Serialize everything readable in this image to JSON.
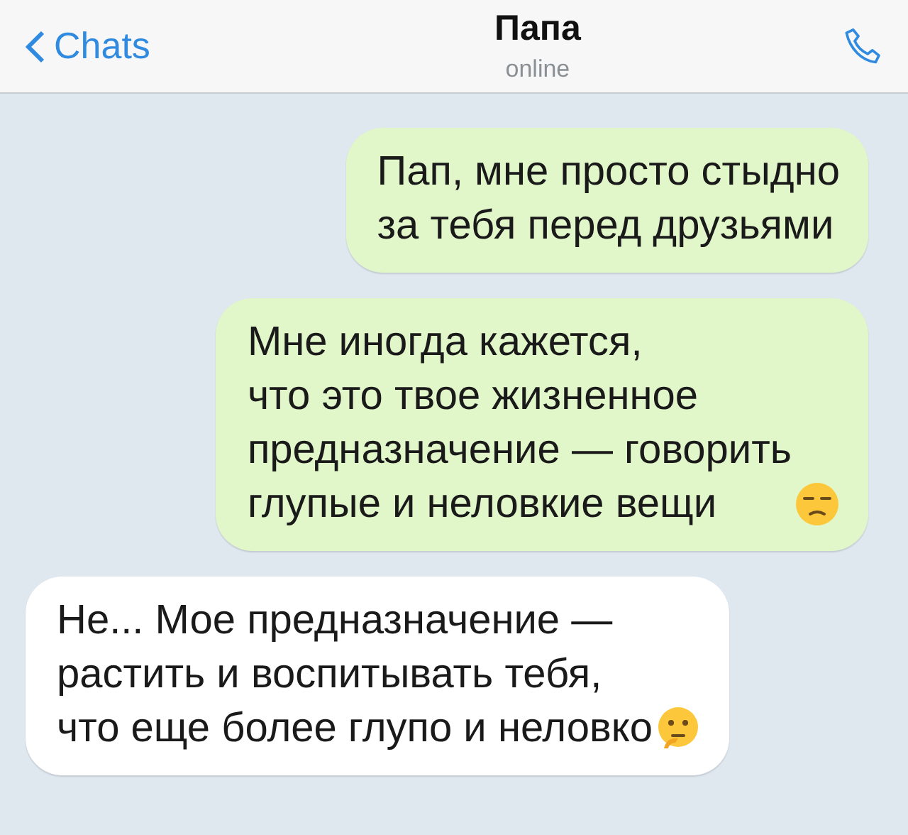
{
  "header": {
    "back": "Chats",
    "title": "Папа",
    "status": "online"
  },
  "messages": [
    {
      "kind": "outgoing",
      "text": "Пап, мне просто стыдно\nза тебя перед друзьями"
    },
    {
      "kind": "outgoing",
      "text": "Мне иногда кажется,\nчто это твое жизненное\nпредназначение — говорить\nглупые и неловкие вещи",
      "emoji": {
        "kind": "unamused"
      }
    },
    {
      "kind": "incoming",
      "text": "Не... Мое предназначение —\nрастить и воспитывать тебя,\nчто еще более глупо и неловко",
      "emoji": {
        "kind": "thinking"
      }
    }
  ]
}
